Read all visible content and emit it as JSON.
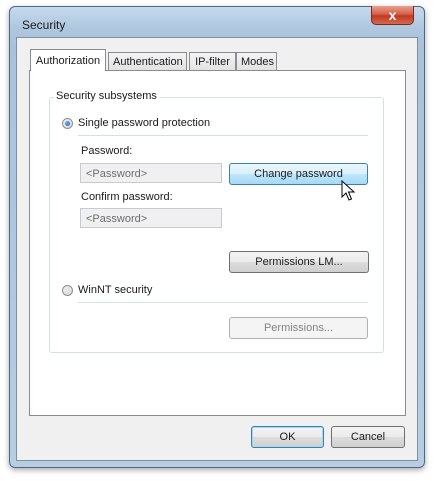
{
  "window": {
    "title": "Security",
    "close_glyph": "x"
  },
  "tabs": [
    {
      "label": "Authorization",
      "active": true
    },
    {
      "label": "Authentication",
      "active": false
    },
    {
      "label": "IP-filter",
      "active": false
    },
    {
      "label": "Modes",
      "active": false
    }
  ],
  "group": {
    "label": "Security subsystems"
  },
  "single_password": {
    "label": "Single password protection",
    "checked": true,
    "password_label": "Password:",
    "password_placeholder": "<Password>",
    "confirm_label": "Confirm password:",
    "confirm_placeholder": "<Password>",
    "change_button": "Change password",
    "permissions_lm_button": "Permissions LM..."
  },
  "winnt": {
    "label": "WinNT security",
    "checked": false,
    "permissions_button": "Permissions..."
  },
  "footer": {
    "ok": "OK",
    "cancel": "Cancel"
  },
  "colors": {
    "frame": "#aec7df",
    "close": "#c2381f",
    "accent": "#3c7fb1"
  },
  "icons": {
    "cursor": "arrow-cursor-icon"
  }
}
